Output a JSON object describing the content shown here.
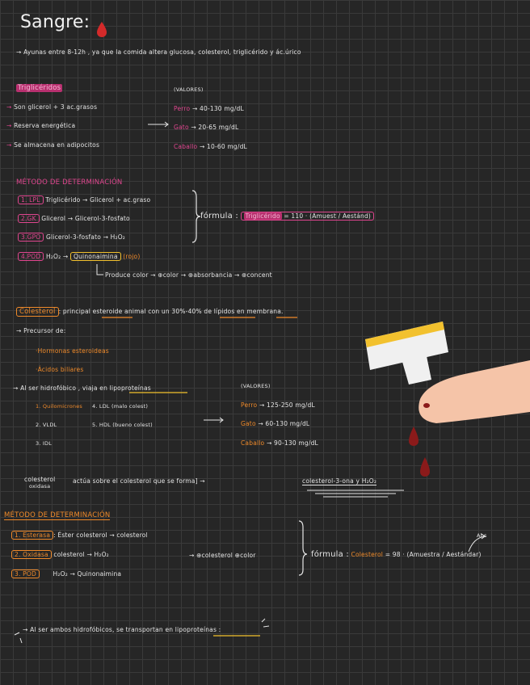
{
  "title": "Sangre:",
  "intro": "→ Ayunas  entre  8-12h , ya  que  la  comida  altera  glucosa, colesterol, triglicérido  y  ác.úrico",
  "trig": {
    "header": "Triglicéridos",
    "valores_label": "(VALORES)",
    "bullets": [
      {
        "arrow": "→",
        "text": "Son  glicerol + 3 ac.grasos"
      },
      {
        "arrow": "→",
        "text": "Reserva  energética"
      },
      {
        "arrow": "→",
        "text": "Se  almacena  en  adipocitos"
      }
    ],
    "values": [
      {
        "animal": "Perro",
        "range": "→ 40-130  mg/dL"
      },
      {
        "animal": "Gato",
        "range": "→ 20-65  mg/dL"
      },
      {
        "animal": "Caballo",
        "range": "→ 10-60  mg/dL"
      }
    ],
    "method_title": "MÉTODO  DE  DETERMINACIÓN",
    "steps": [
      {
        "tag": "1. LPL",
        "text": "Triglicérido → Glicerol + ac.graso"
      },
      {
        "tag": "2.GK",
        "text": "Glicerol → Glicerol-3-fosfato"
      },
      {
        "tag": "3.GPO",
        "text": "Glicerol-3-fosfato → H₂O₂"
      },
      {
        "tag": "4.POD",
        "text": "H₂O₂  →"
      }
    ],
    "quinona": "Quinonaimina",
    "rojo": "(rojo)",
    "produce": "Produce   color  → ⊕color → ⊕absorbancia → ⊕concent",
    "formula_label": "fórmula :",
    "formula_highlight": "Triglicérido",
    "formula_rest": "= 110 · (Amuest / Aestánd)"
  },
  "chol": {
    "header": "Colesterol",
    "desc": ": principal  esteroide  animal   con  un   30%-40%  de  lípidos  en  membrana.",
    "precursor": "→ Precursor  de:",
    "precursor_items": [
      "·Hormonas  esteroideas",
      "·Ácidos  biliares"
    ],
    "hydro": "→ Al  ser  hidrofóbico , viaja  en  lipoproteínas",
    "lipo_col1": [
      "1. Quilomicrones",
      "2. VLDL",
      "3. IDL"
    ],
    "lipo_col2": [
      "4. LDL  (malo  colest)",
      "5. HDL  (bueno  colest)"
    ],
    "valores_label": "(VALORES)",
    "values": [
      {
        "animal": "Perro",
        "range": "→ 125-250  mg/dL"
      },
      {
        "animal": "Gato",
        "range": "→ 60-130  mg/dL"
      },
      {
        "animal": "Caballo",
        "range": "→ 90-130  mg/dL"
      }
    ],
    "oxidasa_line1": "colesterol",
    "oxidasa_line2": "oxidasa",
    "oxidasa_rest": "actúa   sobre   el   colesterol   que   se   forma]  →",
    "oxidasa_result": "colesterol-3-ona  y  H₂O₂",
    "method_title": "MÉTODO  DE  DETERMINACIÓN",
    "steps": [
      {
        "tag": "1. Esterasa",
        "text": ": Éster colesterol  → colesterol"
      },
      {
        "tag": "2. Oxidasa",
        "text": "colesterol  → H₂O₂"
      },
      {
        "tag": "3. POD",
        "text": "H₂O₂ → Quinonaimina"
      }
    ],
    "chain": "→ ⊕colesterol ⊕color",
    "formula_label": "fórmula :",
    "formula_name": "Colesterol",
    "formula_rest": "= 98 · (Amuestra / Aestándar)",
    "annot": "Abs"
  },
  "footer": "→ Al  ser  ambos  hidrofóbicos, se  transportan  en  lipoproteínas :",
  "colors": {
    "pink": "#e0468f",
    "orange": "#ef8a2a",
    "yellow": "#f2c12e",
    "blood": "#8b1a1a",
    "skin": "#f5c4a8"
  }
}
